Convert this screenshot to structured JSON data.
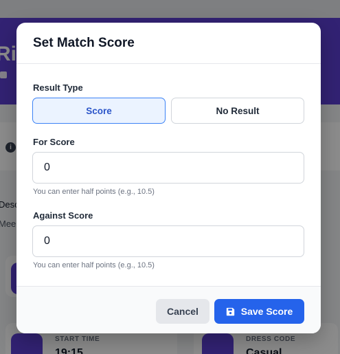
{
  "background": {
    "hero_title": "Ri",
    "description_label": "Desc",
    "description_value": "Mee",
    "cards": [
      {
        "label": "START TIME",
        "value": "19:15"
      },
      {
        "label": "DRESS CODE",
        "value": "Casual"
      }
    ],
    "colors": {
      "hero": "#5b3fd1"
    }
  },
  "modal": {
    "title": "Set Match Score",
    "result_type": {
      "label": "Result Type",
      "options": [
        {
          "label": "Score",
          "selected": true
        },
        {
          "label": "No Result",
          "selected": false
        }
      ]
    },
    "for_score": {
      "label": "For Score",
      "value": "0",
      "hint": "You can enter half points (e.g., 10.5)"
    },
    "against_score": {
      "label": "Against Score",
      "value": "0",
      "hint": "You can enter half points (e.g., 10.5)"
    },
    "footer": {
      "cancel_label": "Cancel",
      "save_label": "Save Score",
      "save_icon": "floppy-disk-icon"
    },
    "colors": {
      "primary": "#2563eb",
      "selected_bg": "#ebf3ff",
      "selected_border": "#3b82f6"
    }
  }
}
